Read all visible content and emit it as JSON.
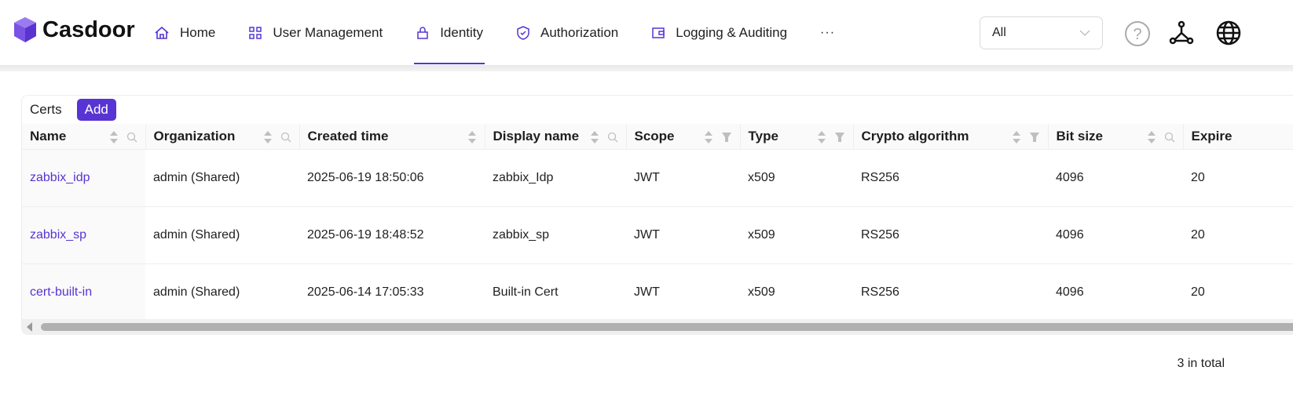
{
  "header": {
    "brand": "Casdoor",
    "nav": [
      {
        "label": "Home",
        "icon": "home-icon"
      },
      {
        "label": "User Management",
        "icon": "grid-icon"
      },
      {
        "label": "Identity",
        "icon": "lock-icon",
        "active": true
      },
      {
        "label": "Authorization",
        "icon": "shield-check-icon"
      },
      {
        "label": "Logging & Auditing",
        "icon": "wallet-icon"
      }
    ],
    "more": "···",
    "org_select": "All"
  },
  "card": {
    "title": "Certs",
    "add_label": "Add"
  },
  "table": {
    "columns": [
      {
        "label": "Name",
        "tool": "search"
      },
      {
        "label": "Organization",
        "tool": "search"
      },
      {
        "label": "Created time",
        "tool": ""
      },
      {
        "label": "Display name",
        "tool": "search"
      },
      {
        "label": "Scope",
        "tool": "filter"
      },
      {
        "label": "Type",
        "tool": "filter"
      },
      {
        "label": "Crypto algorithm",
        "tool": "filter"
      },
      {
        "label": "Bit size",
        "tool": "search"
      },
      {
        "label": "Expire",
        "tool": ""
      }
    ],
    "rows": [
      [
        "zabbix_idp",
        "admin (Shared)",
        "2025-06-19 18:50:06",
        "zabbix_Idp",
        "JWT",
        "x509",
        "RS256",
        "4096",
        "20"
      ],
      [
        "zabbix_sp",
        "admin (Shared)",
        "2025-06-19 18:48:52",
        "zabbix_sp",
        "JWT",
        "x509",
        "RS256",
        "4096",
        "20"
      ],
      [
        "cert-built-in",
        "admin (Shared)",
        "2025-06-14 17:05:33",
        "Built-in Cert",
        "JWT",
        "x509",
        "RS256",
        "4096",
        "20"
      ]
    ]
  },
  "footer": {
    "total": "3 in total"
  },
  "colors": {
    "accent": "#5734d3"
  }
}
